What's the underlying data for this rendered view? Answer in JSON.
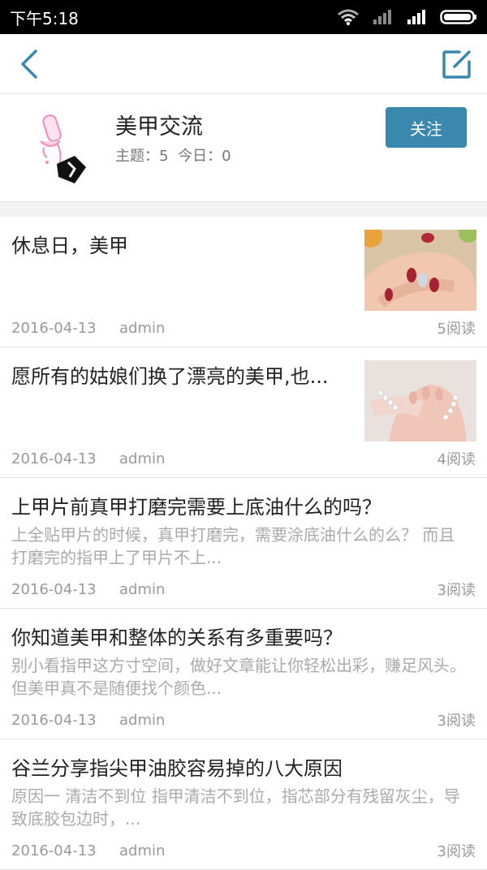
{
  "status": {
    "time": "下午5:18"
  },
  "forum": {
    "title": "美甲交流",
    "topics_label": "主题：5",
    "today_label": "今日：0",
    "follow_label": "关注"
  },
  "posts": [
    {
      "title": "休息日，美甲",
      "excerpt": "",
      "date": "2016-04-13",
      "author": "admin",
      "reads": "5阅读"
    },
    {
      "title": "愿所有的姑娘们换了漂亮的美甲,也...",
      "excerpt": "",
      "date": "2016-04-13",
      "author": "admin",
      "reads": "4阅读"
    },
    {
      "title": "上甲片前真甲打磨完需要上底油什么的吗？",
      "excerpt": "上全贴甲片的时候，真甲打磨完，需要涂底油什么的么？ 而且打磨完的指甲上了甲片不上...",
      "date": "2016-04-13",
      "author": "admin",
      "reads": "3阅读"
    },
    {
      "title": "你知道美甲和整体的关系有多重要吗？",
      "excerpt": "别小看指甲这方寸空间，做好文章能让你轻松出彩，赚足风头。但美甲真不是随便找个颜色...",
      "date": "2016-04-13",
      "author": "admin",
      "reads": "3阅读"
    },
    {
      "title": "谷兰分享指尖甲油胶容易掉的八大原因",
      "excerpt": "原因一  清洁不到位   指甲清洁不到位，指芯部分有残留灰尘，导致底胶包边时，...",
      "date": "2016-04-13",
      "author": "admin",
      "reads": "3阅读"
    }
  ]
}
